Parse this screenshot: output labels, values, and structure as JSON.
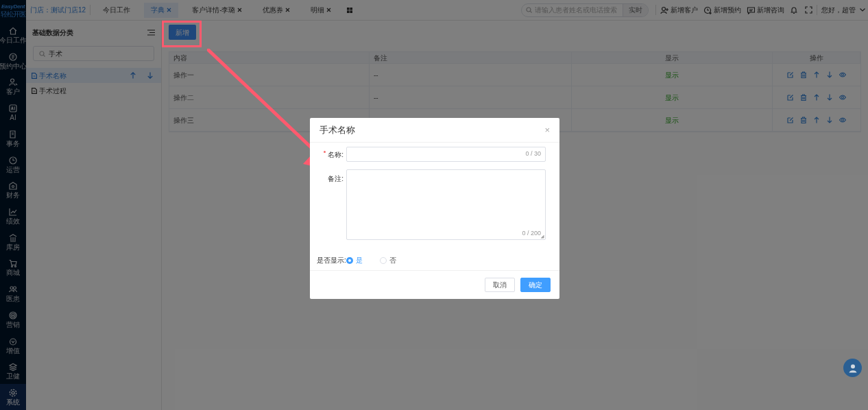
{
  "logo": {
    "name": "EasyDent",
    "subtitle": "轻松开医"
  },
  "nav": [
    {
      "label": "今日工作",
      "selected": false
    },
    {
      "label": "预约中心",
      "selected": false
    },
    {
      "label": "客户",
      "selected": false
    },
    {
      "label": "AI",
      "selected": false
    },
    {
      "label": "事务",
      "selected": false
    },
    {
      "label": "运营",
      "selected": false
    },
    {
      "label": "财务",
      "selected": false
    },
    {
      "label": "绩效",
      "selected": false
    },
    {
      "label": "库房",
      "selected": false
    },
    {
      "label": "商城",
      "selected": false
    },
    {
      "label": "医患",
      "selected": false
    },
    {
      "label": "营销",
      "selected": false
    },
    {
      "label": "增值",
      "selected": false
    },
    {
      "label": "卫健",
      "selected": false
    },
    {
      "label": "系统",
      "selected": true
    }
  ],
  "store": "门店：测试门店12",
  "tabs": [
    {
      "label": "今日工作",
      "selected": false,
      "closable": false
    },
    {
      "label": "字典",
      "selected": true,
      "closable": true
    },
    {
      "label": "客户详情-李璐",
      "selected": false,
      "closable": true
    },
    {
      "label": "优惠券",
      "selected": false,
      "closable": true
    },
    {
      "label": "明细",
      "selected": false,
      "closable": true
    }
  ],
  "header_search": {
    "placeholder": "请输入患者姓名或电话搜索",
    "button": "实时"
  },
  "header_actions": [
    "新增客户",
    "新增预约",
    "新增咨询"
  ],
  "user": "您好，超管",
  "category_panel": {
    "title": "基础数据分类",
    "search": {
      "value": "手术"
    },
    "items": [
      {
        "label": "手术名称",
        "selected": true
      },
      {
        "label": "手术过程",
        "selected": false
      }
    ]
  },
  "add_button": "新增",
  "table": {
    "columns": [
      "内容",
      "备注",
      "显示",
      "操作"
    ],
    "rows": [
      {
        "content": "操作一",
        "remark": "--",
        "display": "显示"
      },
      {
        "content": "操作二",
        "remark": "--",
        "display": "显示"
      },
      {
        "content": "操作三",
        "display": "显示"
      }
    ]
  },
  "dialog": {
    "title": "手术名称",
    "close": "×",
    "fields": [
      {
        "label": "名称:",
        "required": true,
        "kind": "input",
        "counter": "0 / 30"
      },
      {
        "label": "备注:",
        "required": false,
        "kind": "textarea",
        "counter": "0 / 200"
      }
    ],
    "display": {
      "label": "是否显示:",
      "options": [
        {
          "label": "是",
          "selected": true
        },
        {
          "label": "否",
          "selected": false
        }
      ]
    },
    "buttons": [
      {
        "label": "取消",
        "kind": "default"
      },
      {
        "label": "确定",
        "kind": "primary"
      }
    ]
  }
}
